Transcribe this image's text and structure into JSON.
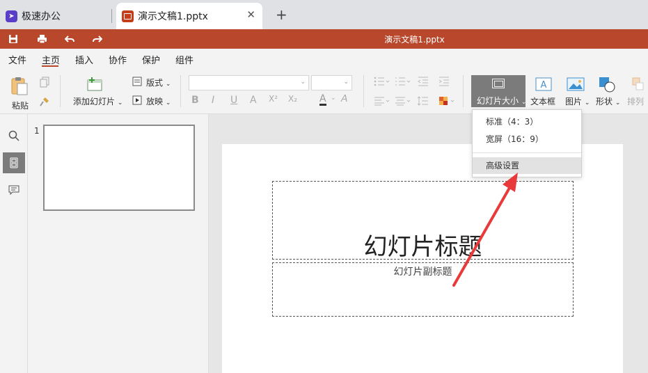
{
  "browser": {
    "tabs": [
      {
        "label": "极速办公",
        "icon": "rocket-app-icon"
      },
      {
        "label": "演示文稿1.pptx",
        "icon": "ppt-file-icon"
      }
    ],
    "close_glyph": "✕",
    "new_tab_glyph": "+"
  },
  "titlebar": {
    "document_title": "演示文稿1.pptx",
    "quick_actions": [
      "save-icon",
      "print-icon",
      "undo-icon",
      "redo-icon"
    ]
  },
  "menu": {
    "items": [
      "文件",
      "主页",
      "插入",
      "协作",
      "保护",
      "组件"
    ],
    "active": "主页"
  },
  "ribbon": {
    "paste_label": "粘贴",
    "add_slide_label": "添加幻灯片",
    "layout_label": "版式",
    "play_label": "放映",
    "slide_size_label": "幻灯片大小",
    "textbox_label": "文本框",
    "image_label": "图片",
    "shape_label": "形状",
    "arrange_label": "排列",
    "format_glyphs": [
      "B",
      "I",
      "U",
      "A",
      "X²",
      "X₂"
    ],
    "font_color_glyph": "A"
  },
  "thumbnails": {
    "slide_number": "1"
  },
  "slide": {
    "title": "幻灯片标题",
    "subtitle": "幻灯片副标题"
  },
  "slide_size_menu": {
    "items": [
      "标准（4：3）",
      "宽屏（16：9）",
      "高级设置"
    ],
    "hovered": "高级设置"
  },
  "colors": {
    "accent": "#b9472c",
    "arrow": "#e83a3a",
    "active_button": "#7b7b7b"
  }
}
